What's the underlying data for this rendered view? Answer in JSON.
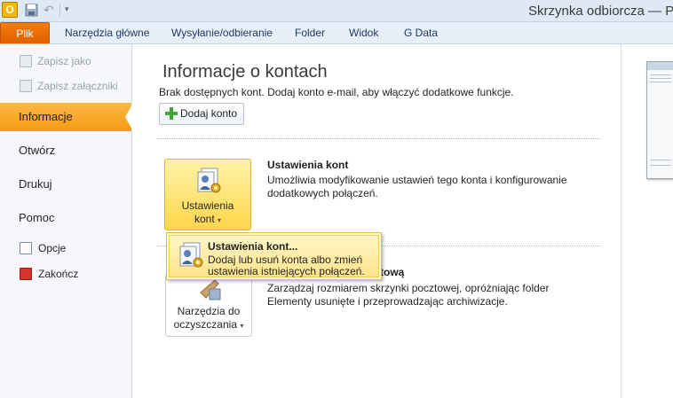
{
  "window": {
    "title": "Skrzynka odbiorcza — Pl",
    "app_icon_label": "O"
  },
  "ribbon": {
    "tabs": [
      {
        "label": "Plik"
      },
      {
        "label": "Narzędzia główne"
      },
      {
        "label": "Wysyłanie/odbieranie"
      },
      {
        "label": "Folder"
      },
      {
        "label": "Widok"
      },
      {
        "label": "G Data"
      }
    ]
  },
  "nav": {
    "save_as": "Zapisz jako",
    "save_attachments": "Zapisz załączniki",
    "items": [
      {
        "label": "Informacje"
      },
      {
        "label": "Otwórz"
      },
      {
        "label": "Drukuj"
      },
      {
        "label": "Pomoc"
      }
    ],
    "options": "Opcje",
    "exit": "Zakończ"
  },
  "main": {
    "title": "Informacje o kontach",
    "subtitle": "Brak dostępnych kont. Dodaj konto e-mail, aby włączyć dodatkowe funkcje.",
    "add_account": "Dodaj konto",
    "account_settings": {
      "button_line1": "Ustawienia",
      "button_line2": "kont",
      "heading": "Ustawienia kont",
      "description": "Umożliwia modyfikowanie ustawień tego konta i konfigurowanie dodatkowych połączeń."
    },
    "cleanup": {
      "button_line1": "Narzędzia do",
      "button_line2": "oczyszczania",
      "heading_visible": "tową",
      "description": "Zarządzaj rozmiarem skrzynki pocztowej, opróżniając folder Elementy usunięte i przeprowadzając archiwizacje."
    }
  },
  "dropdown": {
    "item_title": "Ustawienia kont...",
    "item_text": "Dodaj lub usuń konta albo zmień ustawienia istniejących połączeń."
  },
  "colors": {
    "accent_orange": "#f59a12",
    "file_tab": "#e86a06",
    "highlight_yellow": "#ffd64a"
  }
}
